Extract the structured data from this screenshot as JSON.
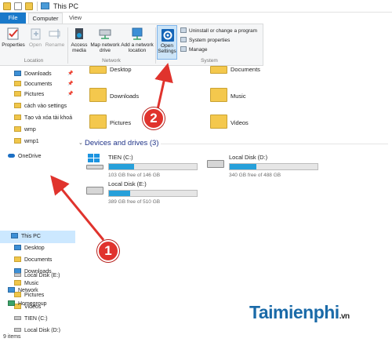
{
  "window": {
    "title": "This PC"
  },
  "tabs": [
    {
      "label": "File"
    },
    {
      "label": "Computer"
    },
    {
      "label": "View"
    }
  ],
  "ribbon": {
    "groups": [
      {
        "label": "Location",
        "buttons": [
          {
            "label": "Properties"
          },
          {
            "label": "Open"
          },
          {
            "label": "Rename"
          }
        ]
      },
      {
        "label": "Network",
        "buttons": [
          {
            "label": "Access media"
          },
          {
            "label": "Map network drive"
          },
          {
            "label": "Add a network location"
          }
        ]
      },
      {
        "label": "System",
        "buttons": [
          {
            "label": "Open Settings"
          }
        ],
        "items": [
          {
            "label": "Uninstall or change a program"
          },
          {
            "label": "System properties"
          },
          {
            "label": "Manage"
          }
        ]
      }
    ]
  },
  "nav": {
    "quick_access": [
      {
        "label": "Downloads",
        "pinned": true
      },
      {
        "label": "Documents",
        "pinned": true
      },
      {
        "label": "Pictures",
        "pinned": true
      },
      {
        "label": "cách vào settings"
      },
      {
        "label": "Tạo và xóa tài khoả"
      },
      {
        "label": "wmp"
      },
      {
        "label": "wmp1"
      }
    ],
    "onedrive": "OneDrive",
    "this_pc": "This PC",
    "this_pc_children": [
      {
        "label": "Desktop"
      },
      {
        "label": "Documents"
      },
      {
        "label": "Downloads"
      },
      {
        "label": "Music"
      },
      {
        "label": "Pictures"
      },
      {
        "label": "Videos"
      },
      {
        "label": "TIEN (C:)"
      },
      {
        "label": "Local Disk (D:)"
      },
      {
        "label": "Local Disk (E:)"
      }
    ],
    "network": "Network",
    "homegroup": "Homegroup"
  },
  "folders": [
    {
      "label": "Desktop"
    },
    {
      "label": "Documents"
    },
    {
      "label": "Downloads"
    },
    {
      "label": "Music"
    },
    {
      "label": "Pictures"
    },
    {
      "label": "Videos"
    }
  ],
  "devices": {
    "heading": "Devices and drives (3)",
    "drives": [
      {
        "name": "TIEN (C:)",
        "free": "103 GB free of 146 GB",
        "used_fraction": 0.29
      },
      {
        "name": "Local Disk (D:)",
        "free": "340 GB free of 488 GB",
        "used_fraction": 0.3
      },
      {
        "name": "Local Disk (E:)",
        "free": "389 GB free of 510 GB",
        "used_fraction": 0.24
      }
    ]
  },
  "annotations": {
    "badge1": "1",
    "badge2": "2"
  },
  "status": {
    "items": "9 items"
  },
  "watermark": {
    "main": "Taimienphi",
    "suffix": ".vn"
  },
  "colors": {
    "accent": "#1979ca",
    "drive_fill": "#26a0da",
    "badge": "#e0332d",
    "arrow": "#e0332d"
  }
}
